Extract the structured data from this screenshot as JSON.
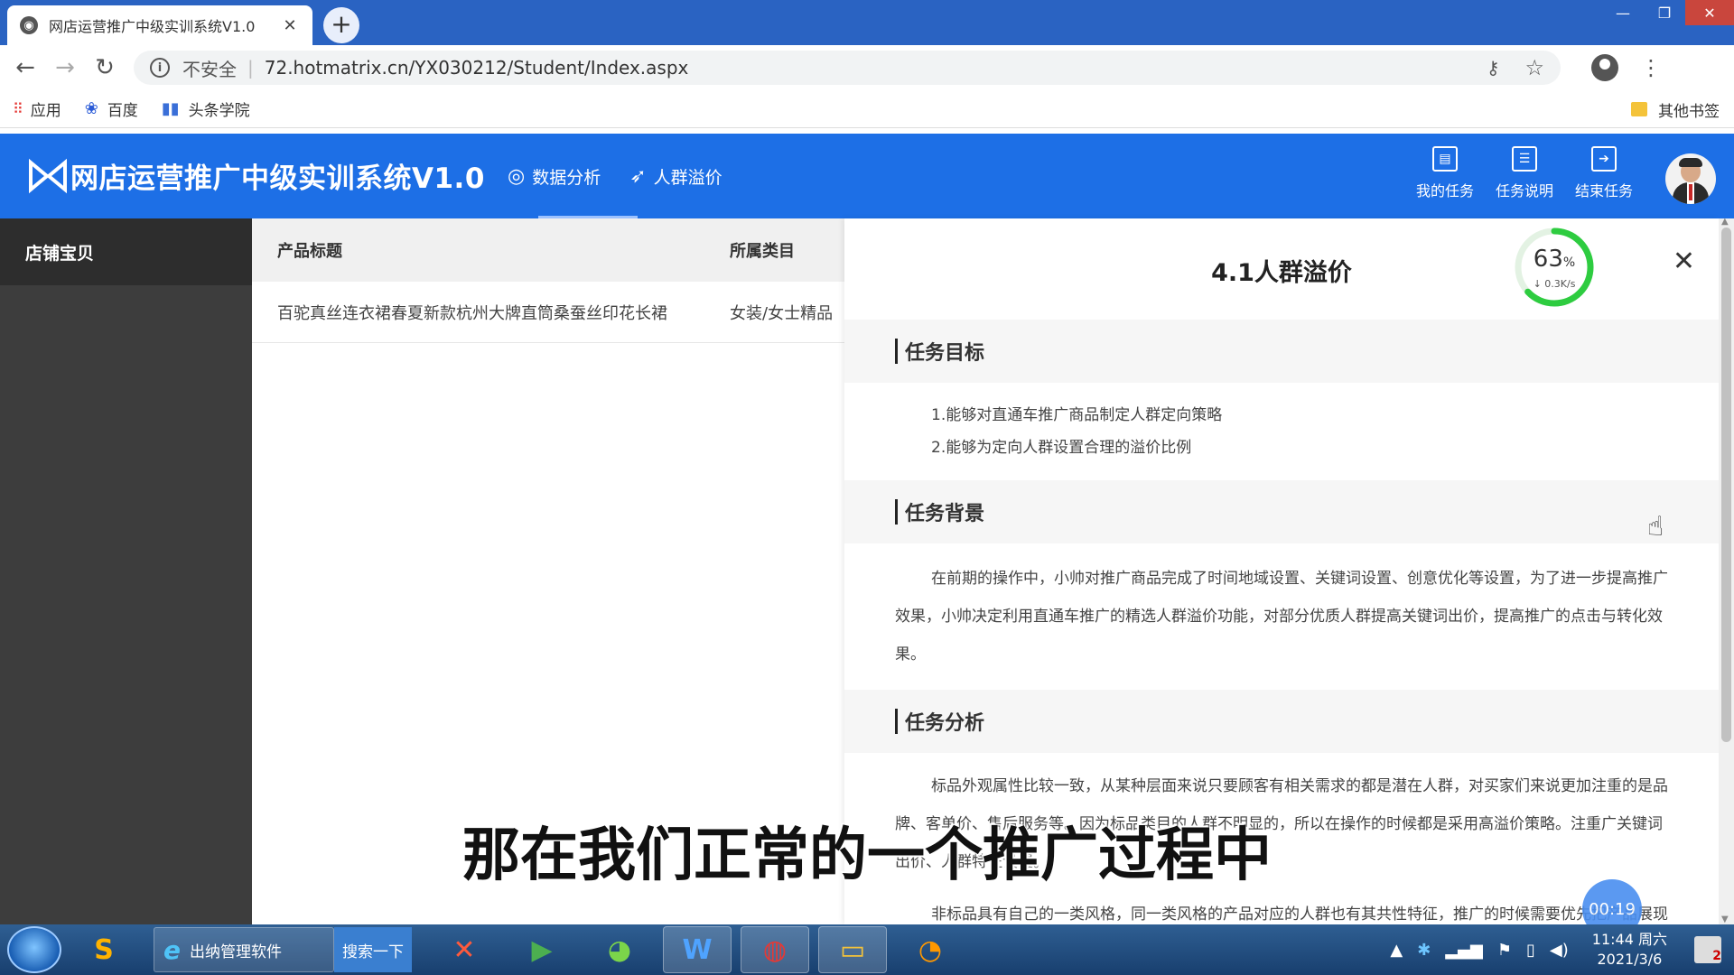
{
  "browser": {
    "tab_title": "网店运营推广中级实训系统V1.0",
    "tab_close": "✕",
    "new_tab": "+",
    "security_label": "不安全",
    "url": "72.hotmatrix.cn/YX030212/Student/Index.aspx",
    "bookmarks": [
      "应用",
      "百度",
      "头条学院"
    ],
    "other_bookmarks": "其他书签"
  },
  "header": {
    "app_title": "网店运营推广中级实训系统V1.0",
    "nav": [
      "数据分析",
      "人群溢价"
    ],
    "actions": [
      "我的任务",
      "任务说明",
      "结束任务"
    ]
  },
  "sidebar": {
    "items": [
      "店铺宝贝"
    ]
  },
  "table": {
    "headers": [
      "产品标题",
      "所属类目"
    ],
    "rows": [
      [
        "百驼真丝连衣裙春夏新款杭州大牌直筒桑蚕丝印花长裙",
        "女装/女士精品"
      ]
    ]
  },
  "panel": {
    "title": "4.1人群溢价",
    "close": "✕",
    "progress_percent": "63",
    "progress_unit": "%",
    "progress_fraction": 0.63,
    "speed": "↓ 0.3K/s",
    "sections": [
      {
        "heading": "任务目标",
        "items": [
          "1.能够对直通车推广商品制定人群定向策略",
          "2.能够为定向人群设置合理的溢价比例"
        ]
      },
      {
        "heading": "任务背景",
        "text": "在前期的操作中，小帅对推广商品完成了时间地域设置、关键词设置、创意优化等设置，为了进一步提高推广效果，小帅决定利用直通车推广的精选人群溢价功能，对部分优质人群提高关键词出价，提高推广的点击与转化效果。"
      },
      {
        "heading": "任务分析",
        "text1": "标品外观属性比较一致，从某种层面来说只要顾客有相关需求的都是潜在人群，对买家们来说更加注重的是品牌、客单价、售后服务等。因为标品类目的人群不明显的，所以在操作的时候都是采用高溢价策略。注重广关键词出价、人群特征设置。",
        "text2": "非标品具有自己的一类风格，同一类风格的产品对应的人群也有其共性特征，推广的时候需要优先把产品展现在这类人群面前，点击率与转化率也就相对较高，对这类人群出比较高"
      }
    ]
  },
  "video": {
    "subtitle": "那在我们正常的一个推广过程中",
    "timer": "00:19"
  },
  "taskbar": {
    "ie_label": "出纳管理软件",
    "search_button": "搜索一下",
    "clock_time": "11:44 周六",
    "clock_date": "2021/3/6",
    "notify_count": "2"
  },
  "colors": {
    "app_header": "#1d6fe6",
    "chrome_tabstrip": "#2a63c2",
    "sidebar": "#3d3d3d",
    "progress_ring": "#2ecc40"
  }
}
